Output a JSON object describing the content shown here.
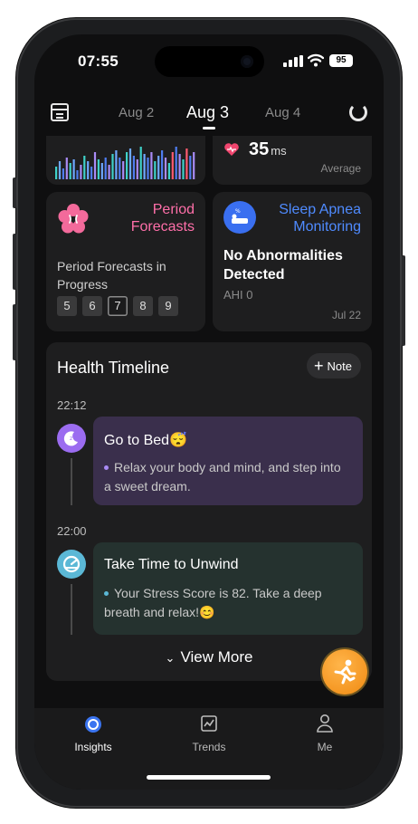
{
  "status_bar": {
    "time": "07:55",
    "battery": "95"
  },
  "date_nav": {
    "prev": "Aug 2",
    "current": "Aug 3",
    "next": "Aug 4"
  },
  "hrv_card": {
    "value": "35",
    "unit": "ms",
    "caption": "Average"
  },
  "period_card": {
    "title_line1": "Period",
    "title_line2": "Forecasts",
    "description": "Period Forecasts in Progress",
    "days": [
      "5",
      "6",
      "7",
      "8",
      "9"
    ],
    "selected_day": "7",
    "accent": "#ff6fa9"
  },
  "apnea_card": {
    "title_line1": "Sleep Apnea",
    "title_line2": "Monitoring",
    "status_line1": "No Abnormalities",
    "status_line2": "Detected",
    "ahi": "AHI 0",
    "date": "Jul 22",
    "accent": "#4f8bff"
  },
  "timeline": {
    "title": "Health Timeline",
    "note_label": "Note",
    "entries": [
      {
        "time": "22:12",
        "title": "Go to Bed😴",
        "body": "Relax your body and mind, and step into a sweet dream.",
        "icon": "moon-icon",
        "color": "#9b6cf0"
      },
      {
        "time": "22:00",
        "title": "Take Time to Unwind",
        "body": "Your Stress Score is 82. Take a deep breath and relax!😊",
        "icon": "gauge-icon",
        "color": "#5bb8d6"
      }
    ],
    "view_more": "View More"
  },
  "tabs": [
    {
      "label": "Insights",
      "icon": "insights-ring-icon",
      "active": true
    },
    {
      "label": "Trends",
      "icon": "trends-chart-icon",
      "active": false
    },
    {
      "label": "Me",
      "icon": "person-icon",
      "active": false
    }
  ]
}
